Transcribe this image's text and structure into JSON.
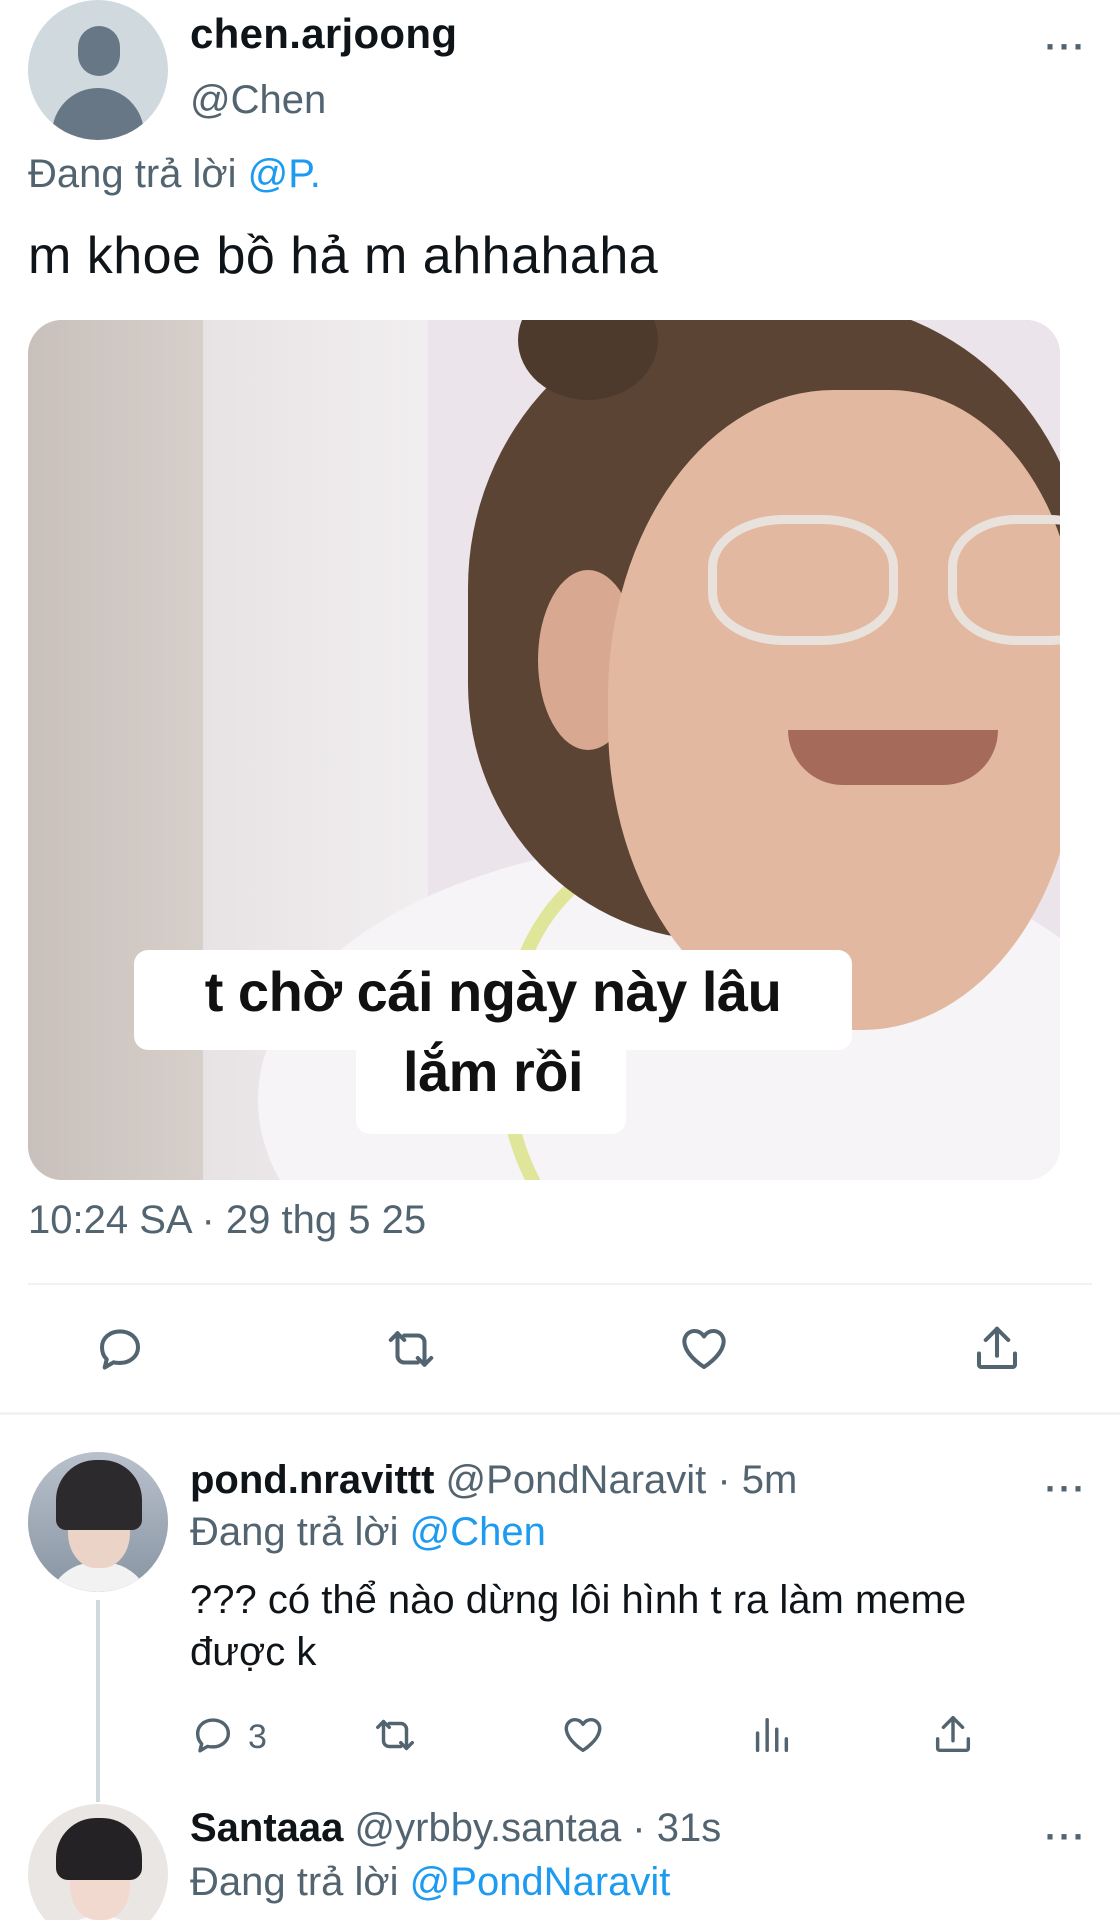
{
  "main_tweet": {
    "display_name": "chen.arjoong",
    "handle": "@Chen",
    "replying_prefix": "Đang trả lời ",
    "replying_to": "@P.",
    "text": "m khoe bồ hả m ahhahaha",
    "media_caption_line1": "t chờ cái ngày này lâu",
    "media_caption_line2": "lắm rồi",
    "timestamp": "10:24 SA · 29 thg 5 25",
    "more_icon": "···"
  },
  "replies": [
    {
      "display_name": "pond.nravittt",
      "meta": " @PondNaravit · 5m",
      "replying_prefix": "Đang trả lời ",
      "replying_to": "@Chen",
      "text": "??? có thể nào dừng lôi hình t ra làm meme được k",
      "reply_count": "3",
      "more_icon": "···"
    },
    {
      "display_name": "Santaaa",
      "meta": " @yrbby.santaa · 31s",
      "replying_prefix": "Đang trả lời ",
      "replying_to": "@PondNaravit",
      "more_icon": "···"
    }
  ],
  "icons": {
    "reply": "reply-icon",
    "retweet": "retweet-icon",
    "like": "heart-icon",
    "share": "share-icon",
    "views": "views-icon"
  },
  "colors": {
    "link": "#1d9bf0",
    "secondary_text": "#536471",
    "primary_text": "#0f1419",
    "divider": "#eff3f4"
  }
}
